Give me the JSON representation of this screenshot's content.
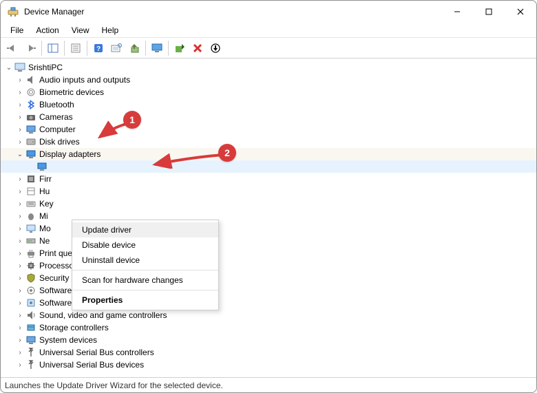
{
  "window": {
    "title": "Device Manager"
  },
  "menu": {
    "file": "File",
    "action": "Action",
    "view": "View",
    "help": "Help"
  },
  "root": {
    "name": "SrishtiPC"
  },
  "categories": [
    {
      "label": "Audio inputs and outputs",
      "icon": "audio"
    },
    {
      "label": "Biometric devices",
      "icon": "biometric"
    },
    {
      "label": "Bluetooth",
      "icon": "bluetooth"
    },
    {
      "label": "Cameras",
      "icon": "camera"
    },
    {
      "label": "Computer",
      "icon": "computer"
    },
    {
      "label": "Disk drives",
      "icon": "disk"
    },
    {
      "label": "Display adapters",
      "icon": "display",
      "expanded": true
    },
    {
      "label": "Firr",
      "icon": "firmware"
    },
    {
      "label": "Hu",
      "icon": "hid"
    },
    {
      "label": "Key",
      "icon": "keyboard"
    },
    {
      "label": "Mi",
      "icon": "mouse"
    },
    {
      "label": "Mo",
      "icon": "monitor"
    },
    {
      "label": "Ne",
      "icon": "network"
    },
    {
      "label": "Print queues",
      "icon": "printer"
    },
    {
      "label": "Processors",
      "icon": "cpu"
    },
    {
      "label": "Security devices",
      "icon": "security"
    },
    {
      "label": "Software components",
      "icon": "softcomp"
    },
    {
      "label": "Software devices",
      "icon": "softdev"
    },
    {
      "label": "Sound, video and game controllers",
      "icon": "sound"
    },
    {
      "label": "Storage controllers",
      "icon": "storage"
    },
    {
      "label": "System devices",
      "icon": "system"
    },
    {
      "label": "Universal Serial Bus controllers",
      "icon": "usb"
    },
    {
      "label": "Universal Serial Bus devices",
      "icon": "usb"
    }
  ],
  "context_menu": {
    "update": "Update driver",
    "disable": "Disable device",
    "uninstall": "Uninstall device",
    "scan": "Scan for hardware changes",
    "properties": "Properties"
  },
  "callouts": {
    "one": "1",
    "two": "2"
  },
  "statusbar": "Launches the Update Driver Wizard for the selected device."
}
